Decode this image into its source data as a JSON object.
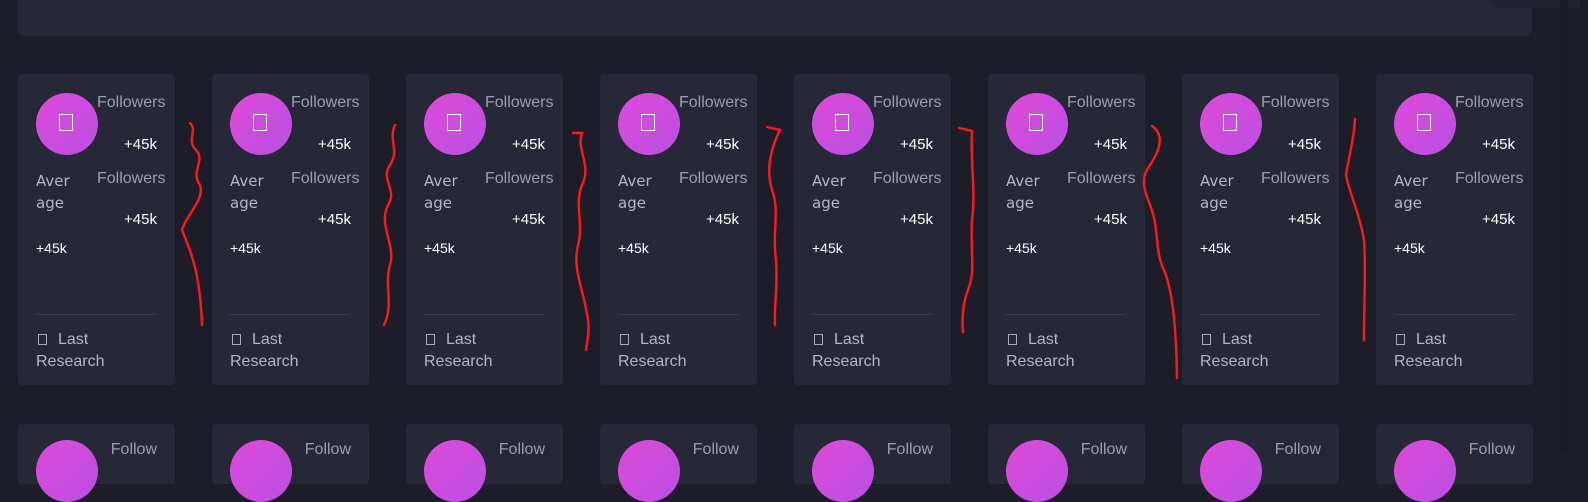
{
  "cards": [
    {
      "followers_label_1": "Followers",
      "followers_value_1": "+45k",
      "followers_label_2": "Followers",
      "followers_value_2": "+45k",
      "average_label": "Average",
      "average_value": "+45k",
      "footer_label": "Last Research"
    },
    {
      "followers_label_1": "Followers",
      "followers_value_1": "+45k",
      "followers_label_2": "Followers",
      "followers_value_2": "+45k",
      "average_label": "Average",
      "average_value": "+45k",
      "footer_label": "Last Research"
    },
    {
      "followers_label_1": "Followers",
      "followers_value_1": "+45k",
      "followers_label_2": "Followers",
      "followers_value_2": "+45k",
      "average_label": "Average",
      "average_value": "+45k",
      "footer_label": "Last Research"
    },
    {
      "followers_label_1": "Followers",
      "followers_value_1": "+45k",
      "followers_label_2": "Followers",
      "followers_value_2": "+45k",
      "average_label": "Average",
      "average_value": "+45k",
      "footer_label": "Last Research"
    },
    {
      "followers_label_1": "Followers",
      "followers_value_1": "+45k",
      "followers_label_2": "Followers",
      "followers_value_2": "+45k",
      "average_label": "Average",
      "average_value": "+45k",
      "footer_label": "Last Research"
    },
    {
      "followers_label_1": "Followers",
      "followers_value_1": "+45k",
      "followers_label_2": "Followers",
      "followers_value_2": "+45k",
      "average_label": "Average",
      "average_value": "+45k",
      "footer_label": "Last Research"
    },
    {
      "followers_label_1": "Followers",
      "followers_value_1": "+45k",
      "followers_label_2": "Followers",
      "followers_value_2": "+45k",
      "average_label": "Average",
      "average_value": "+45k",
      "footer_label": "Last Research"
    },
    {
      "followers_label_1": "Followers",
      "followers_value_1": "+45k",
      "followers_label_2": "Followers",
      "followers_value_2": "+45k",
      "average_label": "Average",
      "average_value": "+45k",
      "footer_label": "Last Research"
    }
  ],
  "row2_cards": [
    {
      "followers_label": "Follow"
    },
    {
      "followers_label": "Follow"
    },
    {
      "followers_label": "Follow"
    },
    {
      "followers_label": "Follow"
    },
    {
      "followers_label": "Follow"
    },
    {
      "followers_label": "Follow"
    },
    {
      "followers_label": "Follow"
    },
    {
      "followers_label": "Follow"
    }
  ],
  "icons": {
    "avatar": "user-icon",
    "footer": "calendar-icon"
  },
  "colors": {
    "background": "#1c1d28",
    "card": "#262838",
    "avatar_gradient_start": "#e04ad8",
    "avatar_gradient_end": "#b84fe3",
    "annotation": "#ff1a1a"
  }
}
